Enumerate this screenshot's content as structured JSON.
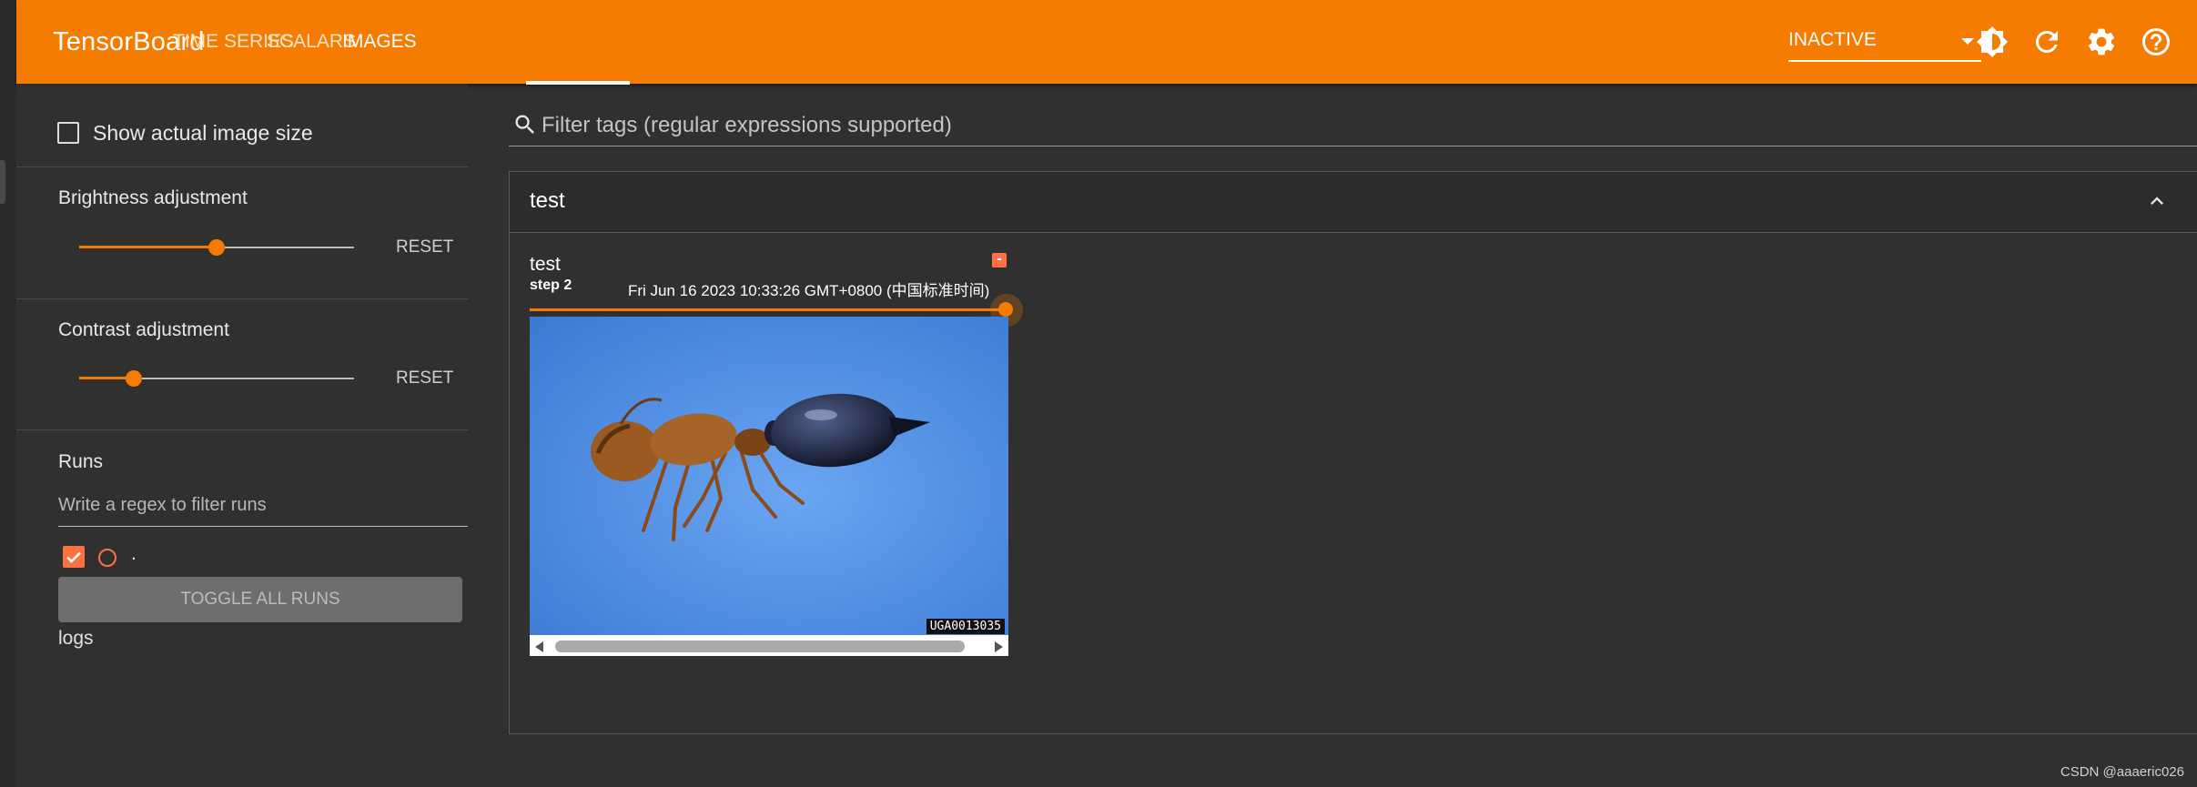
{
  "app": {
    "brand": "TensorBoard",
    "tabs": [
      {
        "label": "TIME SERIES",
        "active": false
      },
      {
        "label": "SCALARS",
        "active": false
      },
      {
        "label": "IMAGES",
        "active": true
      }
    ],
    "reload_status": "INACTIVE",
    "accent_color": "#f57c00",
    "header_icons": [
      "brightness-icon",
      "refresh-icon",
      "settings-icon",
      "help-icon"
    ]
  },
  "sidebar": {
    "show_actual_size_label": "Show actual image size",
    "show_actual_size_checked": false,
    "brightness": {
      "label": "Brightness adjustment",
      "value_fraction": 0.5,
      "reset_label": "RESET"
    },
    "contrast": {
      "label": "Contrast adjustment",
      "value_fraction": 0.2,
      "reset_label": "RESET"
    },
    "runs": {
      "title": "Runs",
      "filter_placeholder": "Write a regex to filter runs",
      "items": [
        {
          "name": ".",
          "checked": true,
          "color": "#ff7043"
        }
      ],
      "toggle_all_label": "TOGGLE ALL RUNS",
      "group_label": "logs"
    }
  },
  "main": {
    "filter_placeholder": "Filter tags (regular expressions supported)",
    "group": {
      "title": "test",
      "cards": [
        {
          "tag": "test",
          "step_label": "step",
          "step_value": "2",
          "timestamp": "Fri Jun 16 2023 10:33:26 GMT+0800 (中国标准时间)",
          "step_slider_fraction": 1.0,
          "image_caption": "UGA0013035",
          "image_subject": "ant on blue background"
        }
      ]
    }
  },
  "footer": {
    "watermark": "CSDN @aaaeric026"
  }
}
